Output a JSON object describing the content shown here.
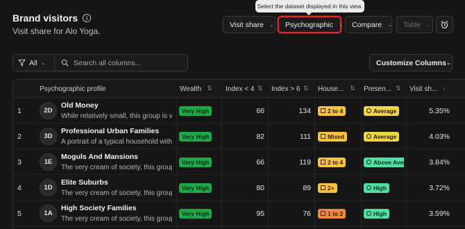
{
  "header": {
    "title": "Brand visitors",
    "subtitle": "Visit share for Alo Yoga."
  },
  "tooltip": {
    "text": "Select the dataset displayed in this view."
  },
  "toolbar": {
    "visit_share": "Visit share",
    "psychographic": "Psychographic",
    "compare": "Compare",
    "table": "Table"
  },
  "filter": {
    "all_label": "All",
    "search_placeholder": "Search all columns..."
  },
  "customize_label": "Customize Columns",
  "columns": {
    "profile": "Psychographic profile",
    "wealth": "Wealth",
    "index_lt": "Index < 4",
    "index_gt": "Index > 6",
    "house": "House...",
    "presence": "Presen...",
    "visit_share": "Visit sh..."
  },
  "rows": [
    {
      "index": "1",
      "code": "2D",
      "name": "Old Money",
      "desc": "While relatively small, this group is very",
      "wealth": "Very High",
      "index_lt": "66",
      "index_gt": "134",
      "house": "2 to 4",
      "house_color": "yellow",
      "presence": "Average",
      "presence_color": "yellow",
      "share": "5.35%"
    },
    {
      "index": "2",
      "code": "3D",
      "name": "Professional Urban Families",
      "desc": "A portrait of a typical household within",
      "wealth": "Very High",
      "index_lt": "82",
      "index_gt": "111",
      "house": "Mixed",
      "house_color": "yellow",
      "presence": "Average",
      "presence_color": "yellow",
      "share": "4.03%"
    },
    {
      "index": "3",
      "code": "1E",
      "name": "Moguls And Mansions",
      "desc": "The very cream of society, this group ea",
      "wealth": "Very High",
      "index_lt": "66",
      "index_gt": "119",
      "house": "2 to 4",
      "house_color": "yellow",
      "presence": "Above Aver",
      "presence_color": "green",
      "share": "3.84%"
    },
    {
      "index": "4",
      "code": "1D",
      "name": "Elite Suburbs",
      "desc": "The very cream of society, this group ea",
      "wealth": "Very High",
      "index_lt": "80",
      "index_gt": "89",
      "house": "2+",
      "house_color": "yellow",
      "presence": "High",
      "presence_color": "green",
      "share": "3.72%"
    },
    {
      "index": "5",
      "code": "1A",
      "name": "High Society Families",
      "desc": "The very cream of society, this group ea",
      "wealth": "Very High",
      "index_lt": "95",
      "index_gt": "76",
      "house": "1 to 2",
      "house_color": "orange",
      "presence": "High",
      "presence_color": "green",
      "share": "3.59%"
    }
  ]
}
